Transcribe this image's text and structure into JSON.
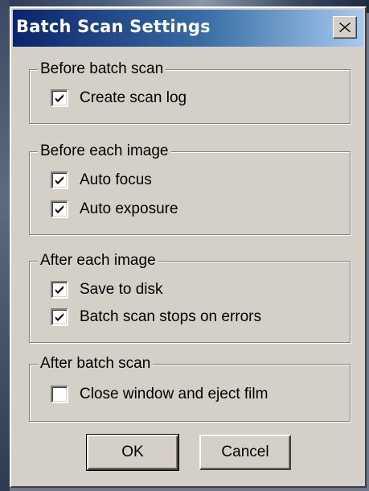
{
  "window": {
    "title": "Batch Scan Settings",
    "close_icon": "close-icon"
  },
  "groups": [
    {
      "legend": "Before batch scan",
      "options": [
        {
          "label": "Create scan log",
          "checked": true
        }
      ]
    },
    {
      "legend": "Before each image",
      "options": [
        {
          "label": "Auto focus",
          "checked": true
        },
        {
          "label": "Auto exposure",
          "checked": true
        }
      ]
    },
    {
      "legend": "After each image",
      "options": [
        {
          "label": "Save to disk",
          "checked": true
        },
        {
          "label": "Batch scan stops on errors",
          "checked": true
        }
      ]
    },
    {
      "legend": "After batch scan",
      "options": [
        {
          "label": "Close window and eject film",
          "checked": false
        }
      ]
    }
  ],
  "buttons": {
    "ok_label": "OK",
    "cancel_label": "Cancel"
  },
  "colors": {
    "title_start": "#0a246a",
    "title_end": "#a6caf0",
    "face": "#d4d0c8"
  }
}
